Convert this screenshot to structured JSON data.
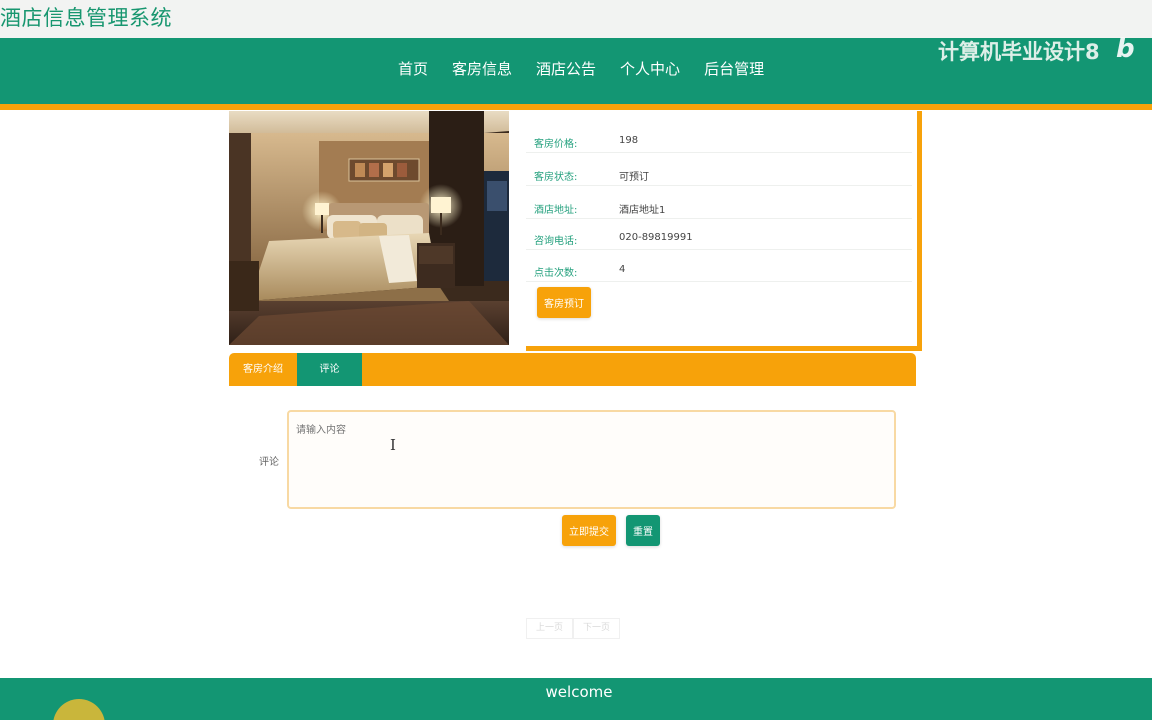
{
  "site": {
    "title": "酒店信息管理系统"
  },
  "nav": {
    "items": [
      {
        "label": "首页"
      },
      {
        "label": "客房信息"
      },
      {
        "label": "酒店公告"
      },
      {
        "label": "个人中心"
      },
      {
        "label": "后台管理"
      }
    ]
  },
  "watermark": {
    "text": "计算机毕业设计8",
    "logo": "bili"
  },
  "room": {
    "details": [
      {
        "label": "客房价格:",
        "value": "198"
      },
      {
        "label": "客房状态:",
        "value": "可预订"
      },
      {
        "label": "酒店地址:",
        "value": "酒店地址1"
      },
      {
        "label": "咨询电话:",
        "value": "020-89819991"
      },
      {
        "label": "点击次数:",
        "value": "4"
      }
    ],
    "book_label": "客房预订"
  },
  "tabs": [
    {
      "label": "客房介绍",
      "active": false
    },
    {
      "label": "评论",
      "active": true
    }
  ],
  "comment": {
    "label": "评论",
    "placeholder": "请输入内容",
    "submit_label": "立即提交",
    "reset_label": "重置"
  },
  "pagination": {
    "prev_label": "上一页",
    "next_label": "下一页"
  },
  "footer": {
    "text": "welcome"
  },
  "colors": {
    "primary": "#139673",
    "accent": "#f7a20a"
  }
}
